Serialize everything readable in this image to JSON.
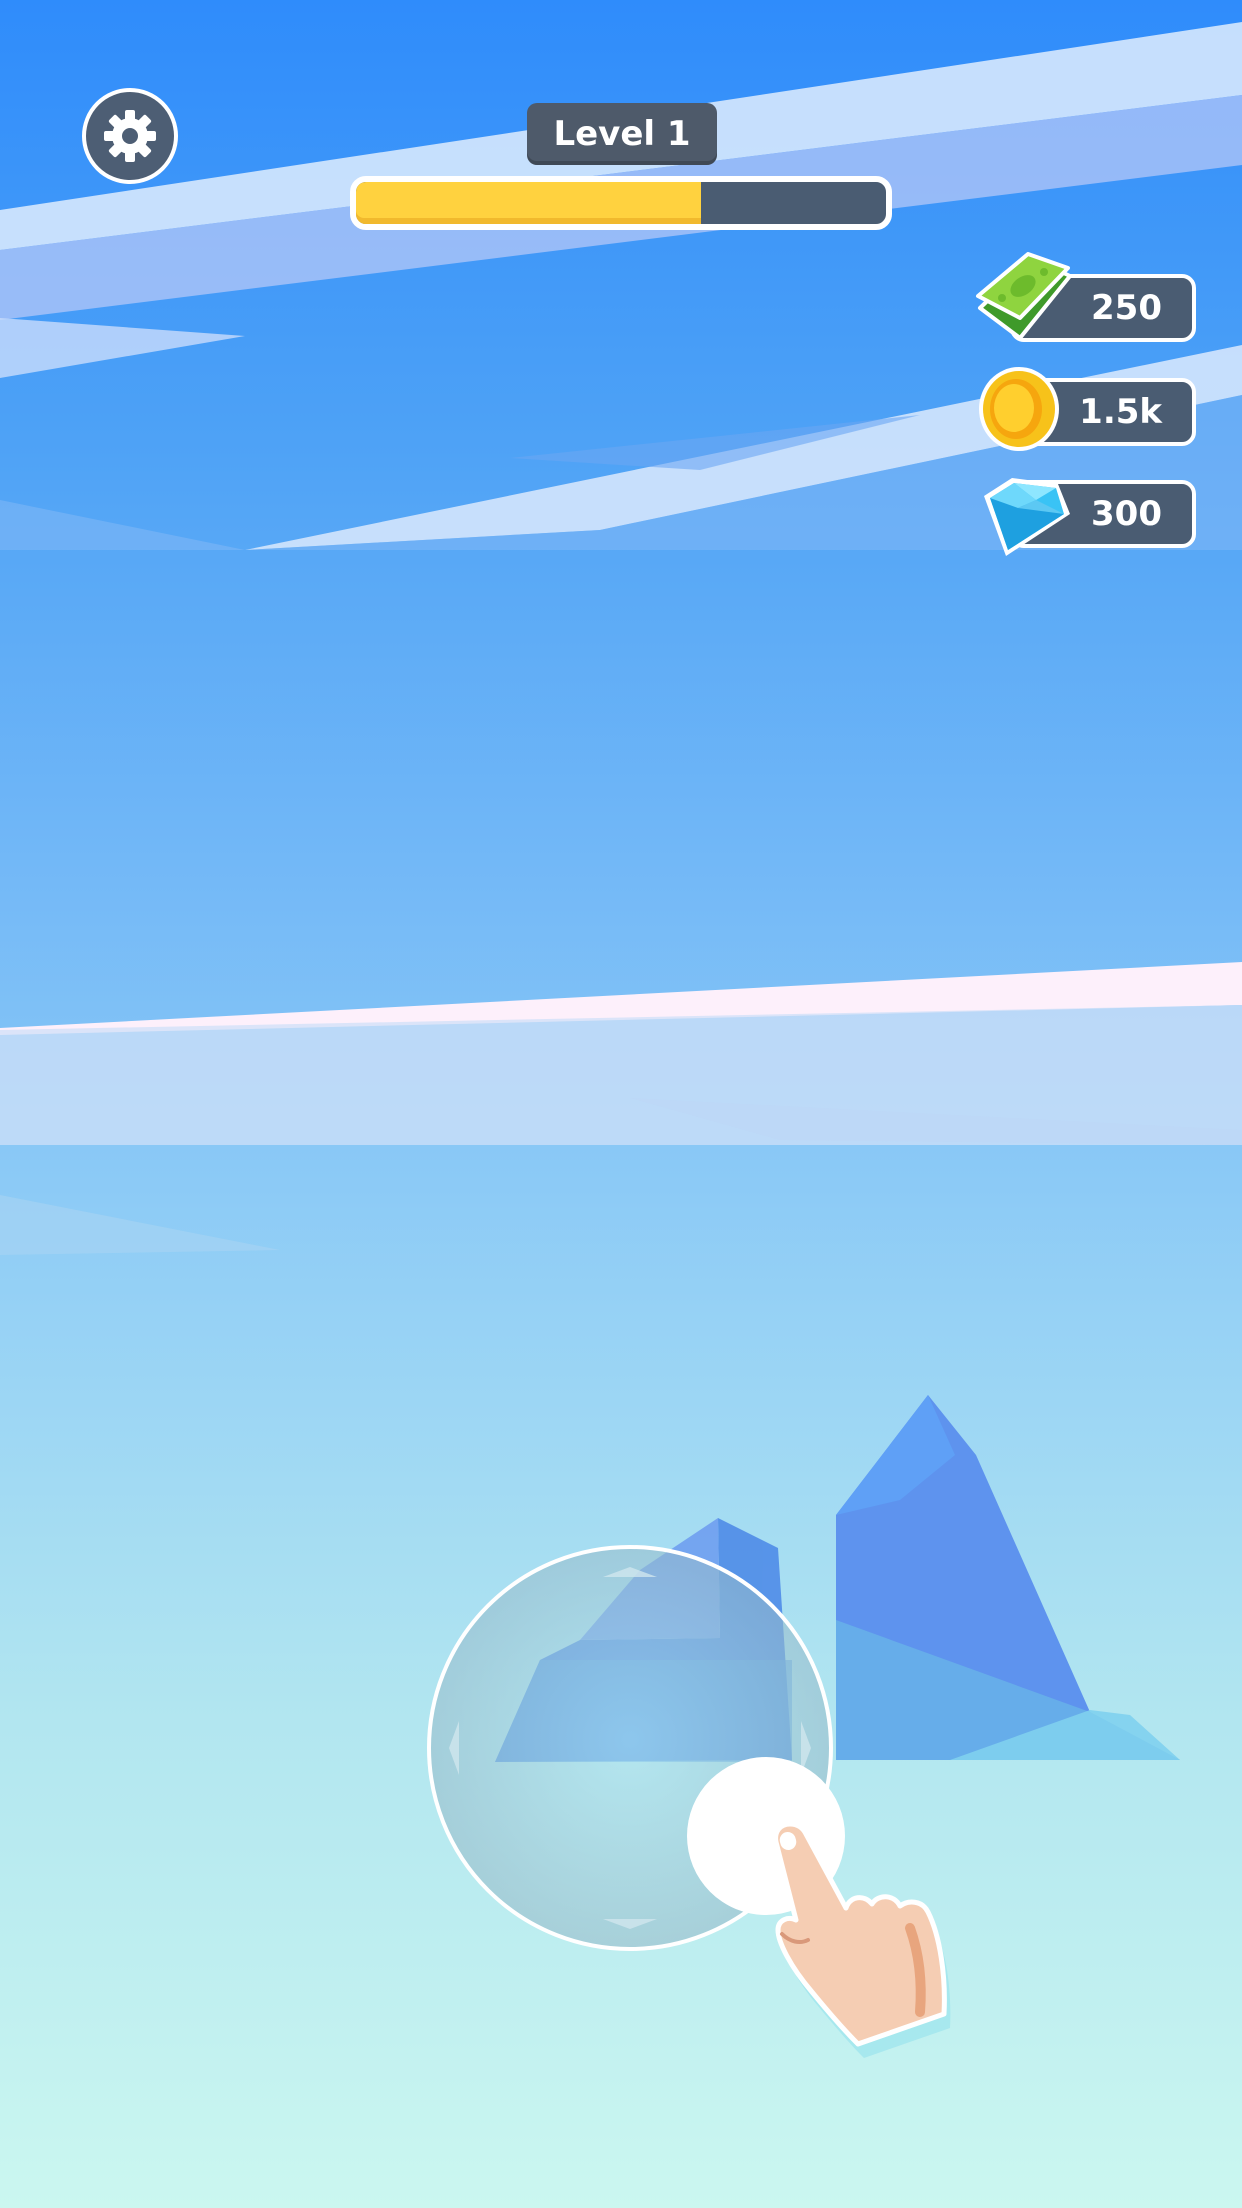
{
  "hud": {
    "level_label": "Level 1",
    "level_progress": 0.65,
    "settings_icon": "gear-icon"
  },
  "currencies": [
    {
      "name": "cash",
      "icon": "cash-icon",
      "value": "250"
    },
    {
      "name": "coins",
      "icon": "coin-icon",
      "value": "1.5k"
    },
    {
      "name": "gems",
      "icon": "gem-icon",
      "value": "300"
    }
  ],
  "tutorial": {
    "joystick_icon": "joystick",
    "hand_icon": "pointing-hand-icon"
  },
  "colors": {
    "sky_top": "#2f8cfb",
    "sky_bottom": "#cbf7f0",
    "panel": "#4a5c72",
    "progress_fill": "#ffd23f",
    "iceberg": "#5a90f0"
  }
}
